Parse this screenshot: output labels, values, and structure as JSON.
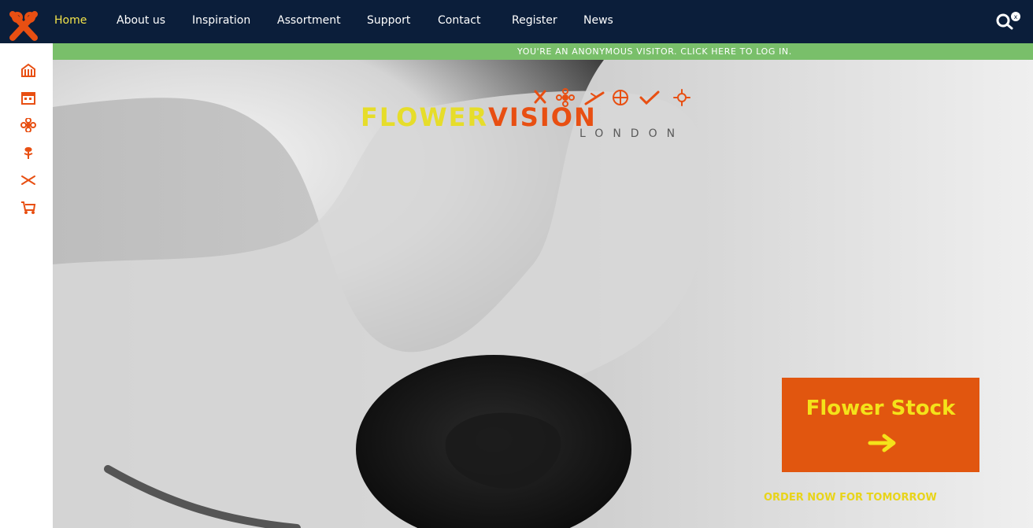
{
  "nav": {
    "items": [
      {
        "label": "Home",
        "active": true
      },
      {
        "label": "About us",
        "active": false
      },
      {
        "label": "Inspiration",
        "active": false
      },
      {
        "label": "Assortment",
        "active": false
      },
      {
        "label": "Support",
        "active": false
      },
      {
        "label": "Contact",
        "active": false
      },
      {
        "label": "Register",
        "active": false
      },
      {
        "label": "News",
        "active": false
      }
    ],
    "search_icon": "search-icon"
  },
  "notice": {
    "text": "YOU'RE AN ANONYMOUS VISITOR. CLICK HERE TO LOG IN."
  },
  "sidebar": {
    "icons": [
      "building-icon",
      "calendar-icon",
      "flower-icon",
      "plant-icon",
      "scissors-icon",
      "cart-icon"
    ]
  },
  "brand": {
    "part1": "FLOWER",
    "part2": "VISION",
    "sub": "LONDON",
    "icon_set": [
      "scissors-icon",
      "flower-icon",
      "knife-icon",
      "flower-outline-icon",
      "check-icon",
      "sun-icon"
    ]
  },
  "cta": {
    "title": "Flower Stock",
    "subtitle": "ORDER NOW FOR TOMORROW"
  },
  "colors": {
    "topbar": "#0b1e3a",
    "green": "#79bf6a",
    "orange": "#e1560f",
    "yellow": "#f4e21a"
  }
}
